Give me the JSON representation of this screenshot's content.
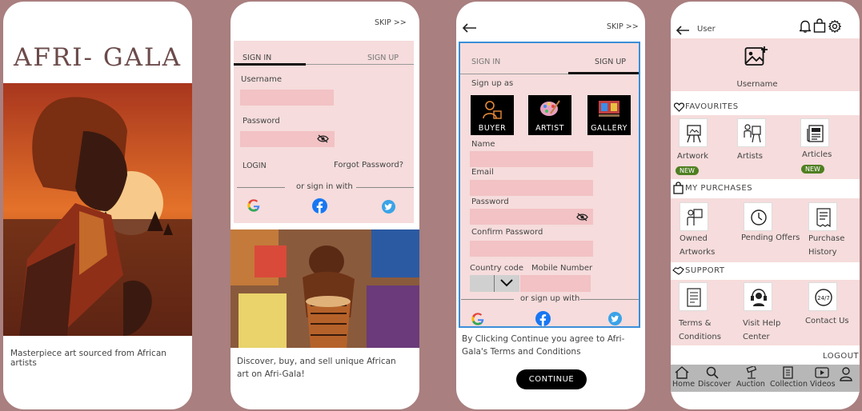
{
  "screen1": {
    "app_title": "AFRI- GALA",
    "tagline": "Masterpiece art sourced from African artists"
  },
  "screen2": {
    "skip": "SKIP >>",
    "tab_signin": "SIGN IN",
    "tab_signup": "SIGN UP",
    "username_label": "Username",
    "password_label": "Password",
    "login": "LOGIN",
    "forgot": "Forgot Password?",
    "or_sign_in_with": "or sign in with",
    "caption": "Discover, buy, and sell unique African art on Afri-Gala!"
  },
  "screen3": {
    "skip": "SKIP >>",
    "tab_signin": "SIGN IN",
    "tab_signup": "SIGN UP",
    "sign_up_as": "Sign up as",
    "roles": [
      "BUYER",
      "ARTIST",
      "GALLERY"
    ],
    "name_label": "Name",
    "email_label": "Email",
    "password_label": "Password",
    "confirm_label": "Confirm Password",
    "country_label": "Country code",
    "mobile_label": "Mobile Number",
    "or_sign_up_with": "or sign up with",
    "terms": "By Clicking Continue you agree to Afri-Gala's Terms and Conditions",
    "continue": "CONTINUE"
  },
  "screen4": {
    "user": "User",
    "username": "Username",
    "favourites": "FAVOURITES",
    "fav_items": [
      "Artwork",
      "Artists",
      "Articles"
    ],
    "new_badge": "NEW",
    "purchases": "MY PURCHASES",
    "purchase_items": [
      "Owned Artworks",
      "Pending Offers",
      "Purchase History"
    ],
    "support": "SUPPORT",
    "support_items": [
      "Terms & Conditions",
      "Visit Help Center",
      "Contact Us"
    ],
    "logout": "LOGOUT",
    "nav": [
      "Home",
      "Discover",
      "Auction",
      "Collection",
      "Videos"
    ]
  },
  "colors": {
    "background": "#a97f7f",
    "pink_panel": "#f6dcdc",
    "field_pink": "#f2c2c4",
    "accent_blue": "#3b8fd9",
    "badge_green": "#4f7f22"
  }
}
